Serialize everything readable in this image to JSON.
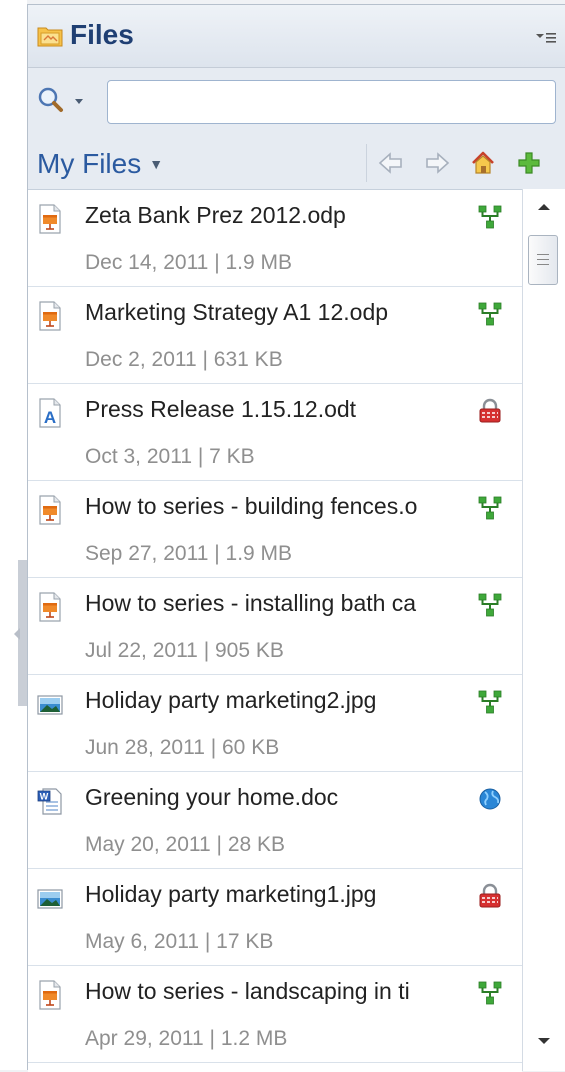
{
  "panel": {
    "title": "Files"
  },
  "search": {
    "value": "",
    "placeholder": ""
  },
  "nav": {
    "location_label": "My Files"
  },
  "files": [
    {
      "name": "Zeta Bank Prez 2012.odp",
      "meta": "Dec 14, 2011  |  1.9 MB",
      "type_icon": "presentation-icon",
      "status_icon": "shared-icon"
    },
    {
      "name": "Marketing Strategy A1 12.odp",
      "meta": "Dec 2, 2011  |  631 KB",
      "type_icon": "presentation-icon",
      "status_icon": "shared-icon"
    },
    {
      "name": "Press Release 1.15.12.odt",
      "meta": "Oct 3, 2011  |  7 KB",
      "type_icon": "text-document-icon",
      "status_icon": "lock-icon"
    },
    {
      "name": "How to series - building fences.o",
      "meta": "Sep 27, 2011  |  1.9 MB",
      "type_icon": "presentation-icon",
      "status_icon": "shared-icon"
    },
    {
      "name": "How to series - installing bath ca",
      "meta": "Jul 22, 2011  |  905 KB",
      "type_icon": "presentation-icon",
      "status_icon": "shared-icon"
    },
    {
      "name": "Holiday party marketing2.jpg",
      "meta": "Jun 28, 2011  |  60 KB",
      "type_icon": "image-icon",
      "status_icon": "shared-icon"
    },
    {
      "name": "Greening your home.doc",
      "meta": "May 20, 2011  |  28 KB",
      "type_icon": "word-document-icon",
      "status_icon": "globe-icon"
    },
    {
      "name": "Holiday party marketing1.jpg",
      "meta": "May 6, 2011  |  17 KB",
      "type_icon": "image-icon",
      "status_icon": "lock-icon"
    },
    {
      "name": "How to series - landscaping in ti",
      "meta": "Apr 29, 2011  |  1.2 MB",
      "type_icon": "presentation-icon",
      "status_icon": "shared-icon"
    }
  ],
  "colors": {
    "title": "#1f3f73",
    "link": "#2b5aa0",
    "meta": "#8f8f8f",
    "shared": "#3fa83a",
    "lock": "#cc2a2a",
    "globe": "#2a86d6"
  }
}
